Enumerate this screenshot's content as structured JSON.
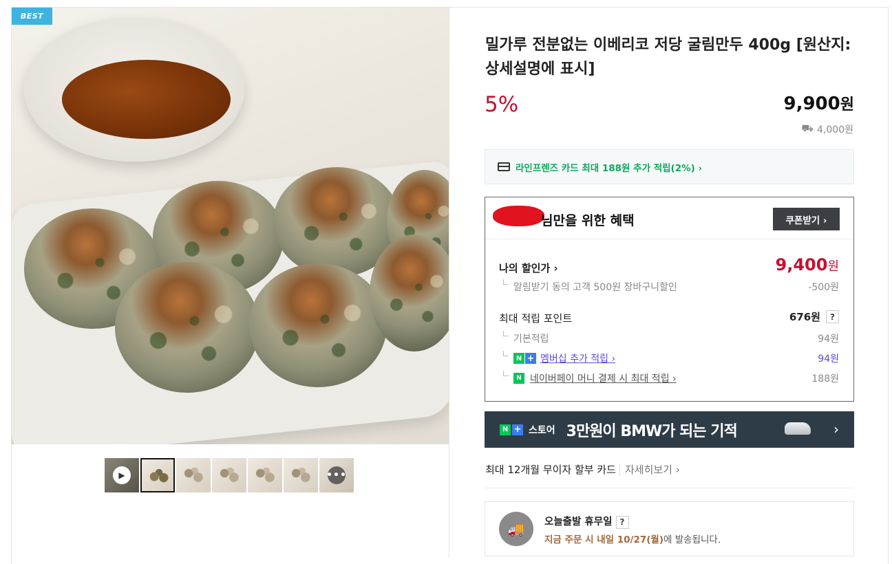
{
  "badge": "BEST",
  "product": {
    "title": "밀가루 전분없는 이베리코 저당 굴림만두 400g [원산지:상세설명에 표시]",
    "discount": "5%",
    "price": "9,900",
    "price_unit": "원",
    "shipping": "4,000원"
  },
  "card_benefit": "라인프렌즈 카드 최대 188원 추가 적립(2%) ›",
  "benefit": {
    "header": "님만을 위한 혜택",
    "coupon_button": "쿠폰받기 ›",
    "my_price_label": "나의 할인가 ›",
    "my_price": "9,400",
    "my_price_unit": "원",
    "my_price_sub": "알림받기 동의 고객 500원 장바구니할인",
    "my_price_sub_value": "-500원",
    "points_label": "최대 적립 포인트",
    "points_value": "676원",
    "help": "?",
    "rows": [
      {
        "label": "기본적립",
        "value": "94원"
      },
      {
        "label": "멤버십 추가 적립 ›",
        "value": "94원"
      },
      {
        "label": "네이버페이 머니 결제 시 최대 적립 ›",
        "value": "188원"
      }
    ]
  },
  "banner": {
    "brand": "스토어",
    "text": "3만원이 BMW가 되는 기적",
    "arrow": "›"
  },
  "installment": {
    "text": "최대 12개월 무이자 할부 카드",
    "more": "자세히보기 ›"
  },
  "holiday": {
    "title": "오늘출발 휴무일",
    "help": "?",
    "sub_prefix": "지금 주문 시 내일 ",
    "sub_date": "10/27(월)",
    "sub_suffix": "에 발송됩니다."
  },
  "thumbnails": [
    "video",
    "main",
    "img3",
    "img4",
    "img5",
    "img6",
    "more"
  ],
  "colors": {
    "discount_red": "#c8102e",
    "naver_green": "#03c75a",
    "badge_blue": "#3fb3e0",
    "banner_bg": "#2e3c47"
  }
}
